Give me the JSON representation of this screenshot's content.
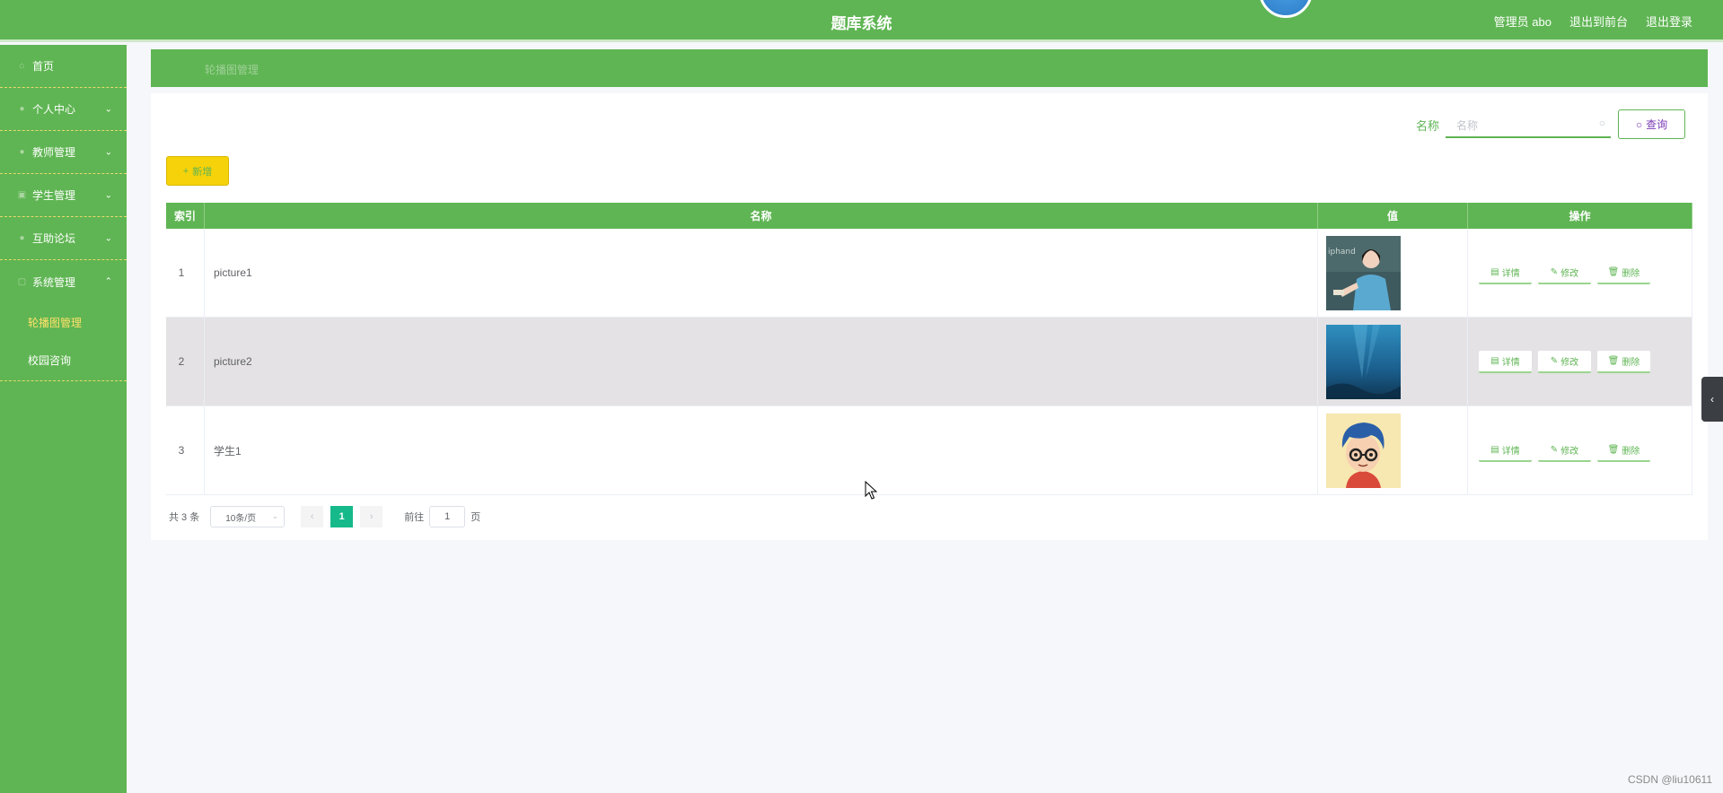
{
  "header": {
    "title": "题库系统",
    "user_label": "管理员 abo",
    "front_link": "退出到前台",
    "logout_link": "退出登录"
  },
  "sidebar": {
    "items": [
      {
        "label": "首页",
        "icon": "home-icon",
        "expandable": false
      },
      {
        "label": "个人中心",
        "icon": "user-icon",
        "expandable": true
      },
      {
        "label": "教师管理",
        "icon": "teacher-icon",
        "expandable": true
      },
      {
        "label": "学生管理",
        "icon": "student-icon",
        "expandable": true
      },
      {
        "label": "互助论坛",
        "icon": "forum-icon",
        "expandable": true
      },
      {
        "label": "系统管理",
        "icon": "system-icon",
        "expandable": true,
        "expanded": true
      }
    ],
    "sub_items": [
      {
        "label": "轮播图管理",
        "active": true
      },
      {
        "label": "校园咨询",
        "active": false
      }
    ]
  },
  "breadcrumb": {
    "current": "轮播图管理"
  },
  "search": {
    "label": "名称",
    "placeholder": "名称",
    "query_button": "查询"
  },
  "actions": {
    "add_button": "新增"
  },
  "table": {
    "headers": [
      "索引",
      "名称",
      "值",
      "操作"
    ],
    "rows": [
      {
        "index": "1",
        "name": "picture1",
        "image": "teacher-photo"
      },
      {
        "index": "2",
        "name": "picture2",
        "image": "underwater-photo"
      },
      {
        "index": "3",
        "name": "学生1",
        "image": "cartoon-avatar"
      }
    ],
    "row_actions": {
      "detail": "详情",
      "edit": "修改",
      "delete": "删除"
    }
  },
  "pagination": {
    "total_text": "共 3 条",
    "page_size": "10条/页",
    "current_page": "1",
    "goto_label": "前往",
    "goto_value": "1",
    "page_suffix": "页"
  },
  "watermark": "CSDN @liu10611",
  "colors": {
    "primary_green": "#5fb553",
    "add_yellow": "#f5d20a",
    "active_page": "#16b98a",
    "active_menu_text": "#ffe16a"
  }
}
